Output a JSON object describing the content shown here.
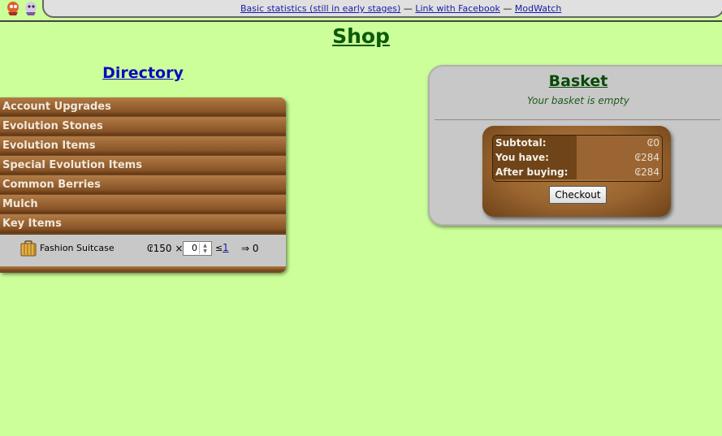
{
  "header": {
    "links": [
      {
        "label": "Basic statistics (still in early stages)"
      },
      {
        "label": "Link with Facebook"
      },
      {
        "label": "ModWatch"
      }
    ],
    "separator": "—"
  },
  "page": {
    "title": "Shop"
  },
  "directory": {
    "title": "Directory",
    "categories": [
      {
        "label": "Account Upgrades"
      },
      {
        "label": "Evolution Stones"
      },
      {
        "label": "Evolution Items"
      },
      {
        "label": "Special Evolution Items"
      },
      {
        "label": "Common Berries"
      },
      {
        "label": "Mulch"
      },
      {
        "label": "Key Items"
      }
    ],
    "items": [
      {
        "icon": "suitcase-icon",
        "name": "Fashion Suitcase",
        "price": "₢150 ×",
        "quantity": "0",
        "leq": "≤",
        "max": "1",
        "total": "⇒ 0"
      }
    ]
  },
  "basket": {
    "title": "Basket",
    "status": "Your basket is empty",
    "rows": [
      {
        "label": "Subtotal:",
        "value": "₢0"
      },
      {
        "label": "You have:",
        "value": "₢284"
      },
      {
        "label": "After buying:",
        "value": "₢284"
      }
    ],
    "checkout_label": "Checkout"
  },
  "colors": {
    "background": "#ccff99",
    "wood": "#9a6332",
    "title_green": "#0a5a0a",
    "link_blue": "#1a1aa6"
  }
}
